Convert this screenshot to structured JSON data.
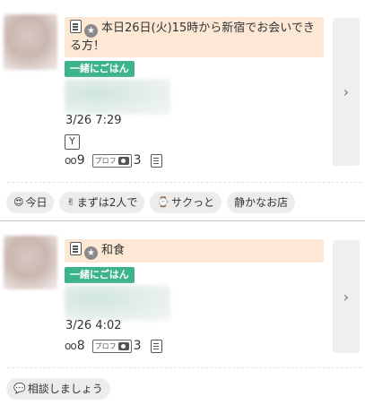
{
  "posts": [
    {
      "title": "本日26日(火)15時から新宿でお会いできる方！",
      "tag": "一緒にごはん",
      "date": "3/26 7:29",
      "views": "9",
      "photos": "3",
      "prof_label": "プロフ",
      "pills": [
        {
          "icon": "😍",
          "label": "今日"
        },
        {
          "icon": "✌",
          "label": "まずは2人で"
        },
        {
          "icon": "⌚",
          "label": "サクっと"
        },
        {
          "icon": "",
          "label": "静かなお店"
        }
      ]
    },
    {
      "title": "和食",
      "tag": "一緒にごはん",
      "date": "3/26 4:02",
      "views": "8",
      "photos": "3",
      "prof_label": "プロフ",
      "pills": [
        {
          "icon": "💬",
          "label": "相談しましょう"
        }
      ]
    }
  ],
  "icons": {
    "document": "document-icon",
    "star": "star-icon",
    "glasses": "glasses-icon",
    "camera": "camera-icon",
    "cup": "cup-icon",
    "chevron": "chevron-right-icon"
  },
  "colors": {
    "title_bg": "#fce8d5",
    "tag_green": "#3cb389",
    "pill_bg": "#ececec",
    "arrow_bg": "#efefef"
  }
}
